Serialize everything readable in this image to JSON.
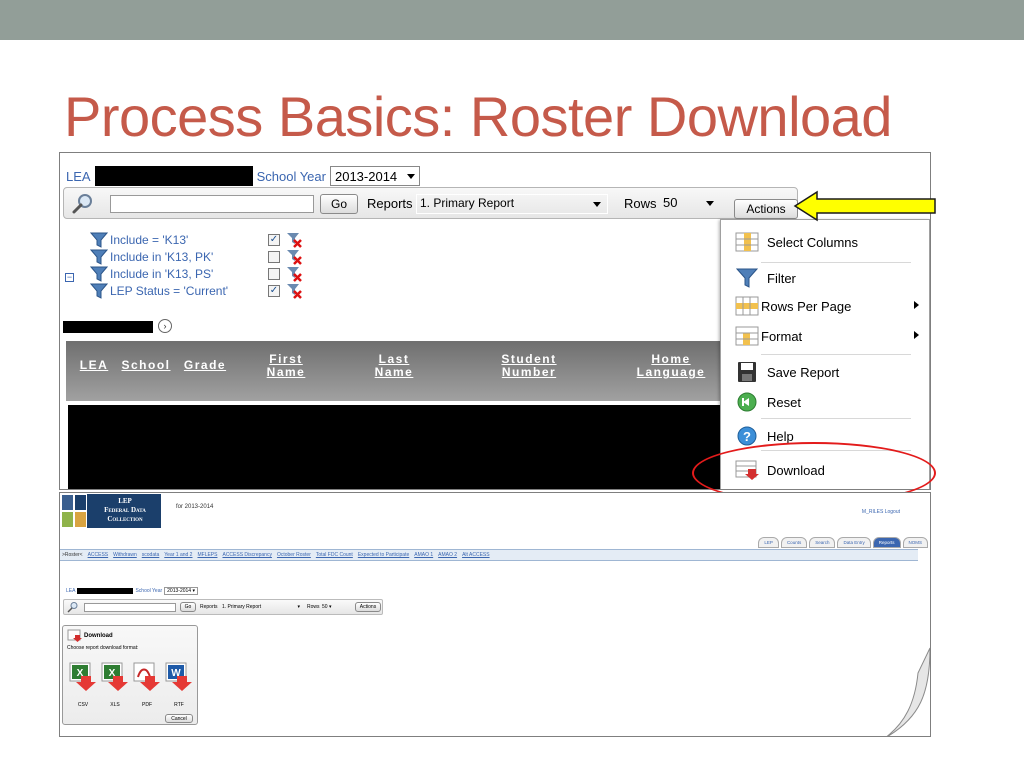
{
  "slide": {
    "title": "Process Basics: Roster Download"
  },
  "screen1": {
    "lea_label": "LEA",
    "school_year_label": "School Year",
    "school_year_value": "2013-2014",
    "go_label": "Go",
    "reports_label": "Reports",
    "reports_value": "1. Primary Report",
    "rows_label": "Rows",
    "rows_value": "50",
    "actions_label": "Actions",
    "filters": [
      {
        "text": "Include = 'K13'",
        "checked": true
      },
      {
        "text": "Include in 'K13, PK'",
        "checked": false
      },
      {
        "text": "Include in 'K13, PS'",
        "checked": false
      },
      {
        "text": "LEP Status = 'Current'",
        "checked": true
      }
    ],
    "columns": [
      {
        "line1": "LEA",
        "line2": ""
      },
      {
        "line1": "School",
        "line2": ""
      },
      {
        "line1": "Grade",
        "line2": ""
      },
      {
        "line1": "First",
        "line2": "Name"
      },
      {
        "line1": "Last",
        "line2": "Name"
      },
      {
        "line1": "Student",
        "line2": "Number"
      },
      {
        "line1": "Home",
        "line2": "Language"
      }
    ],
    "menu": {
      "select_columns": "Select Columns",
      "filter": "Filter",
      "rows_per_page": "Rows Per Page",
      "format": "Format",
      "save_report": "Save Report",
      "reset": "Reset",
      "help": "Help",
      "download": "Download"
    },
    "colors": {
      "highlight_arrow": "#ffff00",
      "highlight_oval": "#e31b1b",
      "link_blue": "#3b66b0"
    }
  },
  "screen2": {
    "logo_line1": "LEP",
    "logo_line2": "Federal Data",
    "logo_line3": "Collection",
    "for_year": "for 2013-2014",
    "user_links": "M_RILES  Logout",
    "tabs": [
      "LEP",
      "Counts",
      "Search",
      "Data Entry",
      "Reports",
      "NOMS"
    ],
    "active_tab": "Reports",
    "nav_first": ">Roster<",
    "nav_links": [
      "ACCESS",
      "Withdrawn",
      "scodata",
      "Year 1 and 2",
      "MFLEPS",
      "ACCESS Discrepancy",
      "October Roster",
      "Total FDC Count",
      "Expected to Participate",
      "AMAO 1",
      "AMAO 2",
      "Alt ACCESS"
    ],
    "lea_label": "LEA",
    "school_year_label": "School Year",
    "school_year_value": "2013-2014",
    "go_label": "Go",
    "reports_label": "Reports",
    "reports_value": "1. Primary Report",
    "rows_label": "Rows",
    "rows_value": "50",
    "actions_label": "Actions",
    "download_title": "Download",
    "download_prompt": "Choose report download format:",
    "formats": [
      "CSV",
      "XLS",
      "PDF",
      "RTF"
    ],
    "cancel_label": "Cancel"
  }
}
